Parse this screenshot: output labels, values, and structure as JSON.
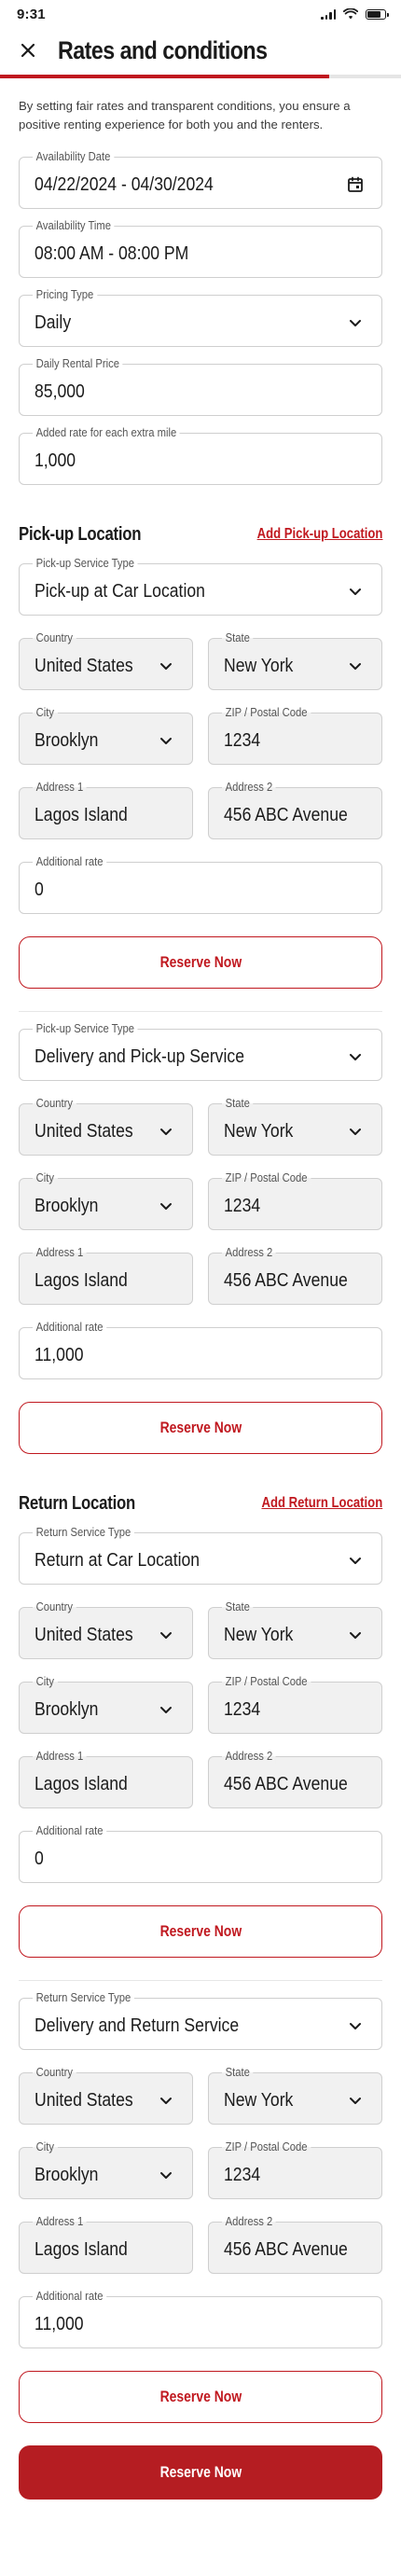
{
  "status_bar": {
    "time": "9:31"
  },
  "header": {
    "title": "Rates and conditions",
    "progress": 0.82
  },
  "intro": "By setting fair rates and transparent conditions, you ensure a positive renting experience for both you and the renters.",
  "rates": {
    "availability_date": {
      "label": "Availability Date",
      "value": "04/22/2024 - 04/30/2024"
    },
    "availability_time": {
      "label": "Availability Time",
      "value": "08:00 AM - 08:00 PM"
    },
    "pricing_type": {
      "label": "Pricing Type",
      "value": "Daily"
    },
    "daily_price": {
      "label": "Daily Rental Price",
      "value": "85,000"
    },
    "extra_mile": {
      "label": "Added rate for each extra mile",
      "value": "1,000"
    }
  },
  "pickup": {
    "title": "Pick-up Location",
    "add_link": "Add Pick-up Location",
    "blocks": [
      {
        "service_label": "Pick-up Service Type",
        "service_value": "Pick-up at Car Location",
        "country_label": "Country",
        "country_value": "United States",
        "state_label": "State",
        "state_value": "New York",
        "city_label": "City",
        "city_value": "Brooklyn",
        "zip_label": "ZIP / Postal Code",
        "zip_value": "1234",
        "address1_label": "Address 1",
        "address1_value": "Lagos Island",
        "address2_label": "Address 2",
        "address2_value": "456 ABC Avenue",
        "rate_label": "Additional rate",
        "rate_value": "0",
        "button": "Reserve Now"
      },
      {
        "service_label": "Pick-up Service Type",
        "service_value": "Delivery and Pick-up Service",
        "country_label": "Country",
        "country_value": "United States",
        "state_label": "State",
        "state_value": "New York",
        "city_label": "City",
        "city_value": "Brooklyn",
        "zip_label": "ZIP / Postal Code",
        "zip_value": "1234",
        "address1_label": "Address 1",
        "address1_value": "Lagos Island",
        "address2_label": "Address 2",
        "address2_value": "456 ABC Avenue",
        "rate_label": "Additional rate",
        "rate_value": "11,000",
        "button": "Reserve Now"
      }
    ]
  },
  "return": {
    "title": "Return Location",
    "add_link": "Add Return Location",
    "blocks": [
      {
        "service_label": "Return Service Type",
        "service_value": "Return at Car Location",
        "country_label": "Country",
        "country_value": "United States",
        "state_label": "State",
        "state_value": "New York",
        "city_label": "City",
        "city_value": "Brooklyn",
        "zip_label": "ZIP / Postal Code",
        "zip_value": "1234",
        "address1_label": "Address 1",
        "address1_value": "Lagos Island",
        "address2_label": "Address 2",
        "address2_value": "456 ABC Avenue",
        "rate_label": "Additional rate",
        "rate_value": "0",
        "button": "Reserve Now"
      },
      {
        "service_label": "Return Service Type",
        "service_value": "Delivery and Return Service",
        "country_label": "Country",
        "country_value": "United States",
        "state_label": "State",
        "state_value": "New York",
        "city_label": "City",
        "city_value": "Brooklyn",
        "zip_label": "ZIP / Postal Code",
        "zip_value": "1234",
        "address1_label": "Address 1",
        "address1_value": "Lagos Island",
        "address2_label": "Address 2",
        "address2_value": "456 ABC Avenue",
        "rate_label": "Additional rate",
        "rate_value": "11,000",
        "button": "Reserve Now"
      }
    ]
  },
  "footer": {
    "primary_button": "Reserve Now"
  },
  "colors": {
    "accent": "#c0181f",
    "primary_button": "#b51d22",
    "disabled_field": "#f1f1f1"
  },
  "icons": [
    "close-icon",
    "calendar-icon",
    "chevron-down-icon",
    "signal-icon",
    "wifi-icon",
    "battery-icon"
  ]
}
